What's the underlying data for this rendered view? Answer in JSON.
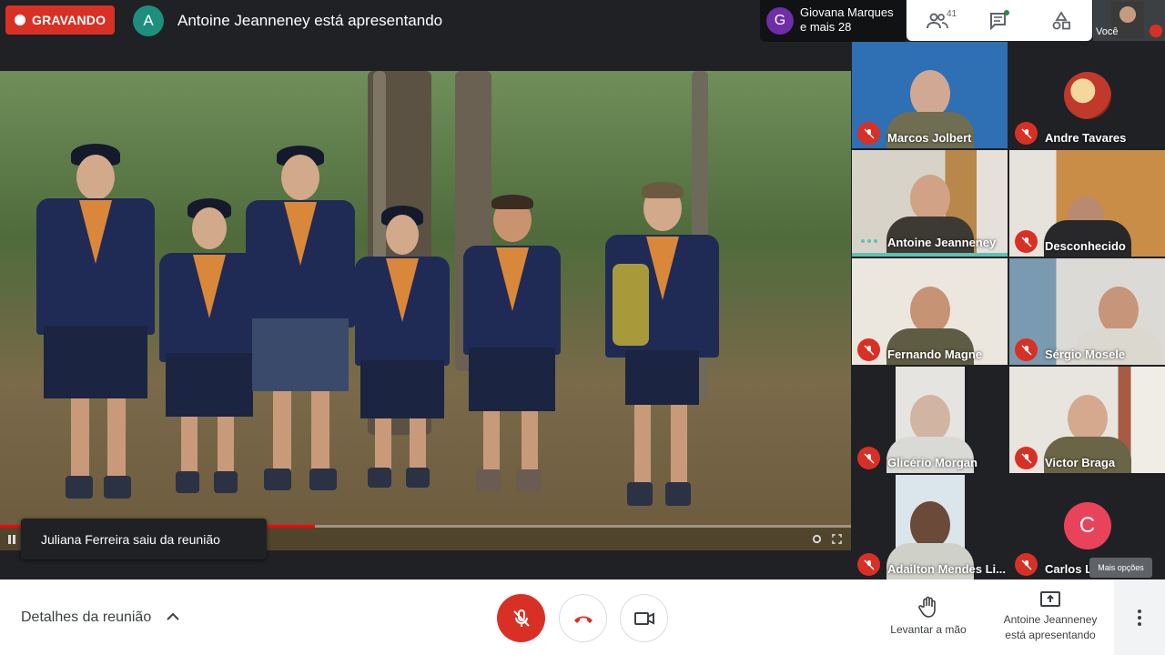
{
  "recording": {
    "label": "GRAVANDO"
  },
  "presenter": {
    "initial": "A",
    "text": "Antoine Jeanneney está apresentando"
  },
  "others": {
    "initial": "G",
    "line1": "Giovana Marques",
    "line2": "e mais 28"
  },
  "toolbar": {
    "people_count": "41"
  },
  "self_view": {
    "label": "Você"
  },
  "toast": {
    "text": "Juliana Ferreira saiu da reunião"
  },
  "video": {
    "progress": 0.37
  },
  "participants": [
    {
      "name": "Marcos Jolbert",
      "muted": true
    },
    {
      "name": "Andre Tavares",
      "muted": true
    },
    {
      "name": "Antoine Jeanneney",
      "muted": false,
      "speaking": true
    },
    {
      "name": "Desconhecido",
      "muted": true
    },
    {
      "name": "Fernando Magne",
      "muted": true
    },
    {
      "name": "Sérgio Mosele",
      "muted": true
    },
    {
      "name": "Glicério Morgan",
      "muted": true
    },
    {
      "name": "Victor Braga",
      "muted": true
    },
    {
      "name": "Adailton Mendes Li...",
      "muted": true
    },
    {
      "name": "Carlos Le",
      "muted": true,
      "initial": "C"
    }
  ],
  "tooltip": {
    "text": "Mais opções"
  },
  "bottom": {
    "details": "Detalhes da reunião",
    "raise_hand": "Levantar a mão",
    "presenting_line1": "Antoine Jeanneney",
    "presenting_line2": "está apresentando"
  },
  "colors": {
    "record_red": "#d93025",
    "presenter_avatar": "#1e8e7e",
    "others_avatar": "#6f2da8",
    "carlos_avatar": "#e8435a",
    "speaking": "#5ec2b3"
  }
}
